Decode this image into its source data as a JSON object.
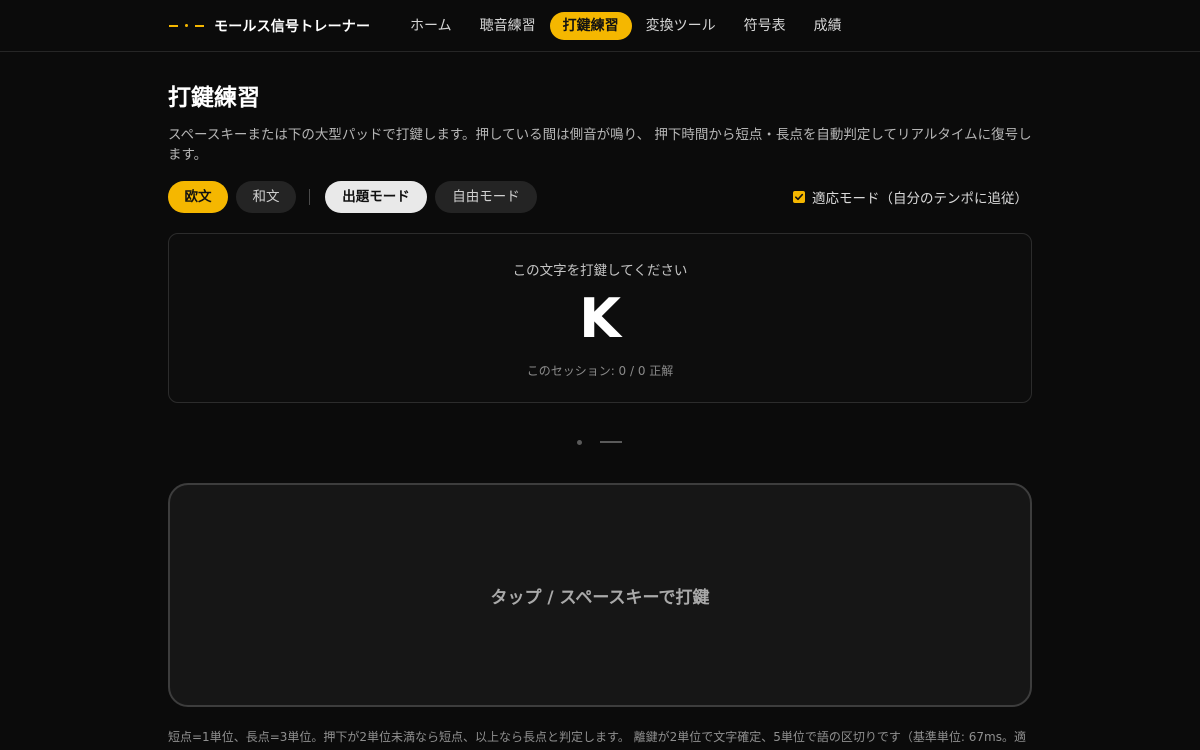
{
  "brand": {
    "name": "モールス信号トレーナー",
    "icon": "morse-logo-icon",
    "accent": "#f5b700"
  },
  "nav": {
    "items": [
      {
        "label": "ホーム",
        "active": false
      },
      {
        "label": "聴音練習",
        "active": false
      },
      {
        "label": "打鍵練習",
        "active": true
      },
      {
        "label": "変換ツール",
        "active": false
      },
      {
        "label": "符号表",
        "active": false
      },
      {
        "label": "成績",
        "active": false
      }
    ]
  },
  "page": {
    "title": "打鍵練習",
    "description": "スペースキーまたは下の大型パッドで打鍵します。押している間は側音が鳴り、 押下時間から短点・長点を自動判定してリアルタイムに復号します。"
  },
  "controls": {
    "language": {
      "options": [
        "欧文",
        "和文"
      ],
      "selected": "欧文"
    },
    "mode": {
      "options": [
        "出題モード",
        "自由モード"
      ],
      "selected": "出題モード"
    },
    "adaptive": {
      "label": "適応モード（自分のテンポに追従）",
      "checked": true
    }
  },
  "target": {
    "prompt": "この文字を打鍵してください",
    "character": "K",
    "session": "このセッション: 0 / 0 正解"
  },
  "signal": {
    "elements": [
      "dot",
      "dash"
    ]
  },
  "pad": {
    "label": "タップ / スペースキーで打鍵"
  },
  "footnote": "短点=1単位、長点=3単位。押下が2単位未満なら短点、以上なら長点と判定します。 離鍵が2単位で文字確定、5単位で語の区切りです（基準単位: 67ms。適"
}
